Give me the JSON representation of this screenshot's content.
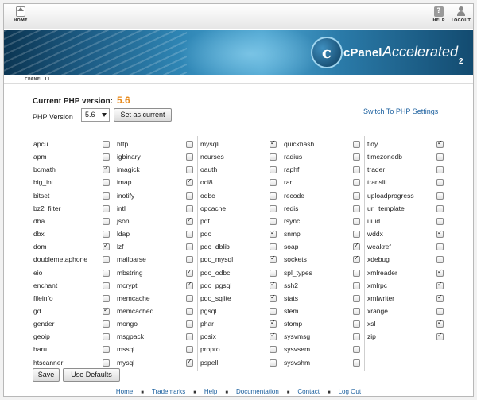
{
  "topbar": {
    "home_label": "HOME",
    "help_label": "HELP",
    "logout_label": "LOGOUT"
  },
  "banner": {
    "brand_cpanel": "cPanel",
    "brand_accelerated": "Accelerated",
    "brand_version": "2",
    "logo_letter": "c"
  },
  "subbar": {
    "version_label": "CPANEL 11"
  },
  "php": {
    "current_label": "Current PHP version:",
    "current_value": "5.6",
    "version_label": "PHP Version",
    "selected_version": "5.6",
    "set_current_label": "Set as current",
    "switch_label": "Switch To PHP Settings"
  },
  "extensions": [
    [
      {
        "name": "apcu",
        "checked": false
      },
      {
        "name": "apm",
        "checked": false
      },
      {
        "name": "bcmath",
        "checked": true
      },
      {
        "name": "big_int",
        "checked": false
      },
      {
        "name": "bitset",
        "checked": false
      },
      {
        "name": "bz2_filter",
        "checked": false
      },
      {
        "name": "dba",
        "checked": false
      },
      {
        "name": "dbx",
        "checked": false
      },
      {
        "name": "dom",
        "checked": true
      },
      {
        "name": "doublemetaphone",
        "checked": false
      },
      {
        "name": "eio",
        "checked": false
      },
      {
        "name": "enchant",
        "checked": false
      },
      {
        "name": "fileinfo",
        "checked": false
      },
      {
        "name": "gd",
        "checked": true
      },
      {
        "name": "gender",
        "checked": false
      },
      {
        "name": "geoip",
        "checked": false
      },
      {
        "name": "haru",
        "checked": false
      },
      {
        "name": "htscanner",
        "checked": false
      }
    ],
    [
      {
        "name": "http",
        "checked": false
      },
      {
        "name": "igbinary",
        "checked": false
      },
      {
        "name": "imagick",
        "checked": false
      },
      {
        "name": "imap",
        "checked": true
      },
      {
        "name": "inotify",
        "checked": false
      },
      {
        "name": "intl",
        "checked": false
      },
      {
        "name": "json",
        "checked": true
      },
      {
        "name": "ldap",
        "checked": false
      },
      {
        "name": "lzf",
        "checked": false
      },
      {
        "name": "mailparse",
        "checked": false
      },
      {
        "name": "mbstring",
        "checked": true
      },
      {
        "name": "mcrypt",
        "checked": true
      },
      {
        "name": "memcache",
        "checked": false
      },
      {
        "name": "memcached",
        "checked": false
      },
      {
        "name": "mongo",
        "checked": false
      },
      {
        "name": "msgpack",
        "checked": false
      },
      {
        "name": "mssql",
        "checked": false
      },
      {
        "name": "mysql",
        "checked": true
      }
    ],
    [
      {
        "name": "mysqli",
        "checked": true
      },
      {
        "name": "ncurses",
        "checked": false
      },
      {
        "name": "oauth",
        "checked": false
      },
      {
        "name": "oci8",
        "checked": false
      },
      {
        "name": "odbc",
        "checked": false
      },
      {
        "name": "opcache",
        "checked": false
      },
      {
        "name": "pdf",
        "checked": false
      },
      {
        "name": "pdo",
        "checked": true
      },
      {
        "name": "pdo_dblib",
        "checked": false
      },
      {
        "name": "pdo_mysql",
        "checked": true
      },
      {
        "name": "pdo_odbc",
        "checked": false
      },
      {
        "name": "pdo_pgsql",
        "checked": true
      },
      {
        "name": "pdo_sqlite",
        "checked": true
      },
      {
        "name": "pgsql",
        "checked": false
      },
      {
        "name": "phar",
        "checked": true
      },
      {
        "name": "posix",
        "checked": true
      },
      {
        "name": "propro",
        "checked": false
      },
      {
        "name": "pspell",
        "checked": false
      }
    ],
    [
      {
        "name": "quickhash",
        "checked": false
      },
      {
        "name": "radius",
        "checked": false
      },
      {
        "name": "raphf",
        "checked": false
      },
      {
        "name": "rar",
        "checked": false
      },
      {
        "name": "recode",
        "checked": false
      },
      {
        "name": "redis",
        "checked": false
      },
      {
        "name": "rsync",
        "checked": false
      },
      {
        "name": "snmp",
        "checked": false
      },
      {
        "name": "soap",
        "checked": true
      },
      {
        "name": "sockets",
        "checked": true
      },
      {
        "name": "spl_types",
        "checked": false
      },
      {
        "name": "ssh2",
        "checked": false
      },
      {
        "name": "stats",
        "checked": false
      },
      {
        "name": "stem",
        "checked": false
      },
      {
        "name": "stomp",
        "checked": false
      },
      {
        "name": "sysvmsg",
        "checked": false
      },
      {
        "name": "sysvsem",
        "checked": false
      },
      {
        "name": "sysvshm",
        "checked": false
      }
    ],
    [
      {
        "name": "tidy",
        "checked": true
      },
      {
        "name": "timezonedb",
        "checked": false
      },
      {
        "name": "trader",
        "checked": false
      },
      {
        "name": "translit",
        "checked": false
      },
      {
        "name": "uploadprogress",
        "checked": false
      },
      {
        "name": "uri_template",
        "checked": false
      },
      {
        "name": "uuid",
        "checked": false
      },
      {
        "name": "wddx",
        "checked": true
      },
      {
        "name": "weakref",
        "checked": false
      },
      {
        "name": "xdebug",
        "checked": false
      },
      {
        "name": "xmlreader",
        "checked": true
      },
      {
        "name": "xmlrpc",
        "checked": true
      },
      {
        "name": "xmlwriter",
        "checked": true
      },
      {
        "name": "xrange",
        "checked": false
      },
      {
        "name": "xsl",
        "checked": true
      },
      {
        "name": "zip",
        "checked": true
      }
    ]
  ],
  "actions": {
    "save_label": "Save",
    "defaults_label": "Use Defaults"
  },
  "footer": {
    "links": [
      "Home",
      "Trademarks",
      "Help",
      "Documentation",
      "Contact",
      "Log Out"
    ]
  }
}
